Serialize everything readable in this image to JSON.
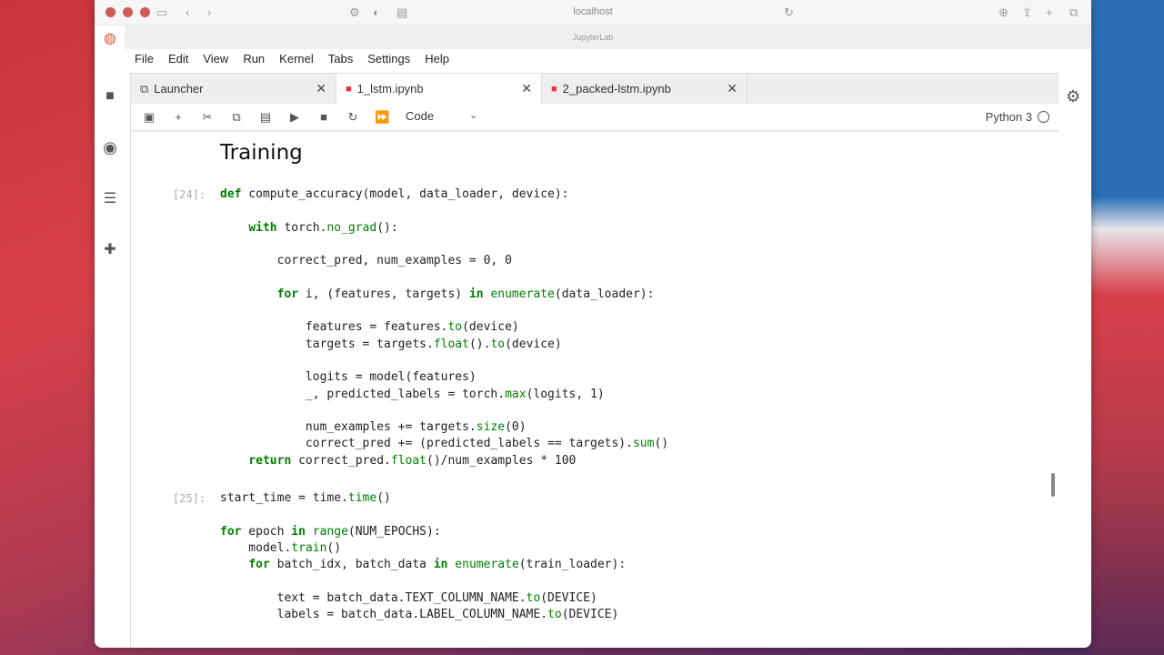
{
  "browser": {
    "url": "localhost",
    "tab_title": "JupyterLab"
  },
  "menu": [
    "File",
    "Edit",
    "View",
    "Run",
    "Kernel",
    "Tabs",
    "Settings",
    "Help"
  ],
  "doc_tabs": [
    {
      "label": "Launcher",
      "icon": "launcher-icon"
    },
    {
      "label": "1_lstm.ipynb",
      "icon": "notebook-icon"
    },
    {
      "label": "2_packed-lstm.ipynb",
      "icon": "notebook-icon"
    }
  ],
  "toolbar": {
    "cell_type": "Code",
    "kernel": "Python 3"
  },
  "notebook": {
    "heading": "Training",
    "cells": [
      {
        "prompt": "[24]:",
        "lines": [
          "def compute_accuracy(model, data_loader, device):",
          "",
          "    with torch.no_grad():",
          "",
          "        correct_pred, num_examples = 0, 0",
          "",
          "        for i, (features, targets) in enumerate(data_loader):",
          "",
          "            features = features.to(device)",
          "            targets = targets.float().to(device)",
          "",
          "            logits = model(features)",
          "            _, predicted_labels = torch.max(logits, 1)",
          "",
          "            num_examples += targets.size(0)",
          "            correct_pred += (predicted_labels == targets).sum()",
          "    return correct_pred.float()/num_examples * 100"
        ]
      },
      {
        "prompt": "[25]:",
        "lines": [
          "start_time = time.time()",
          "",
          "for epoch in range(NUM_EPOCHS):",
          "    model.train()",
          "    for batch_idx, batch_data in enumerate(train_loader):",
          "",
          "        text = batch_data.TEXT_COLUMN_NAME.to(DEVICE)",
          "        labels = batch_data.LABEL_COLUMN_NAME.to(DEVICE)"
        ]
      }
    ]
  }
}
